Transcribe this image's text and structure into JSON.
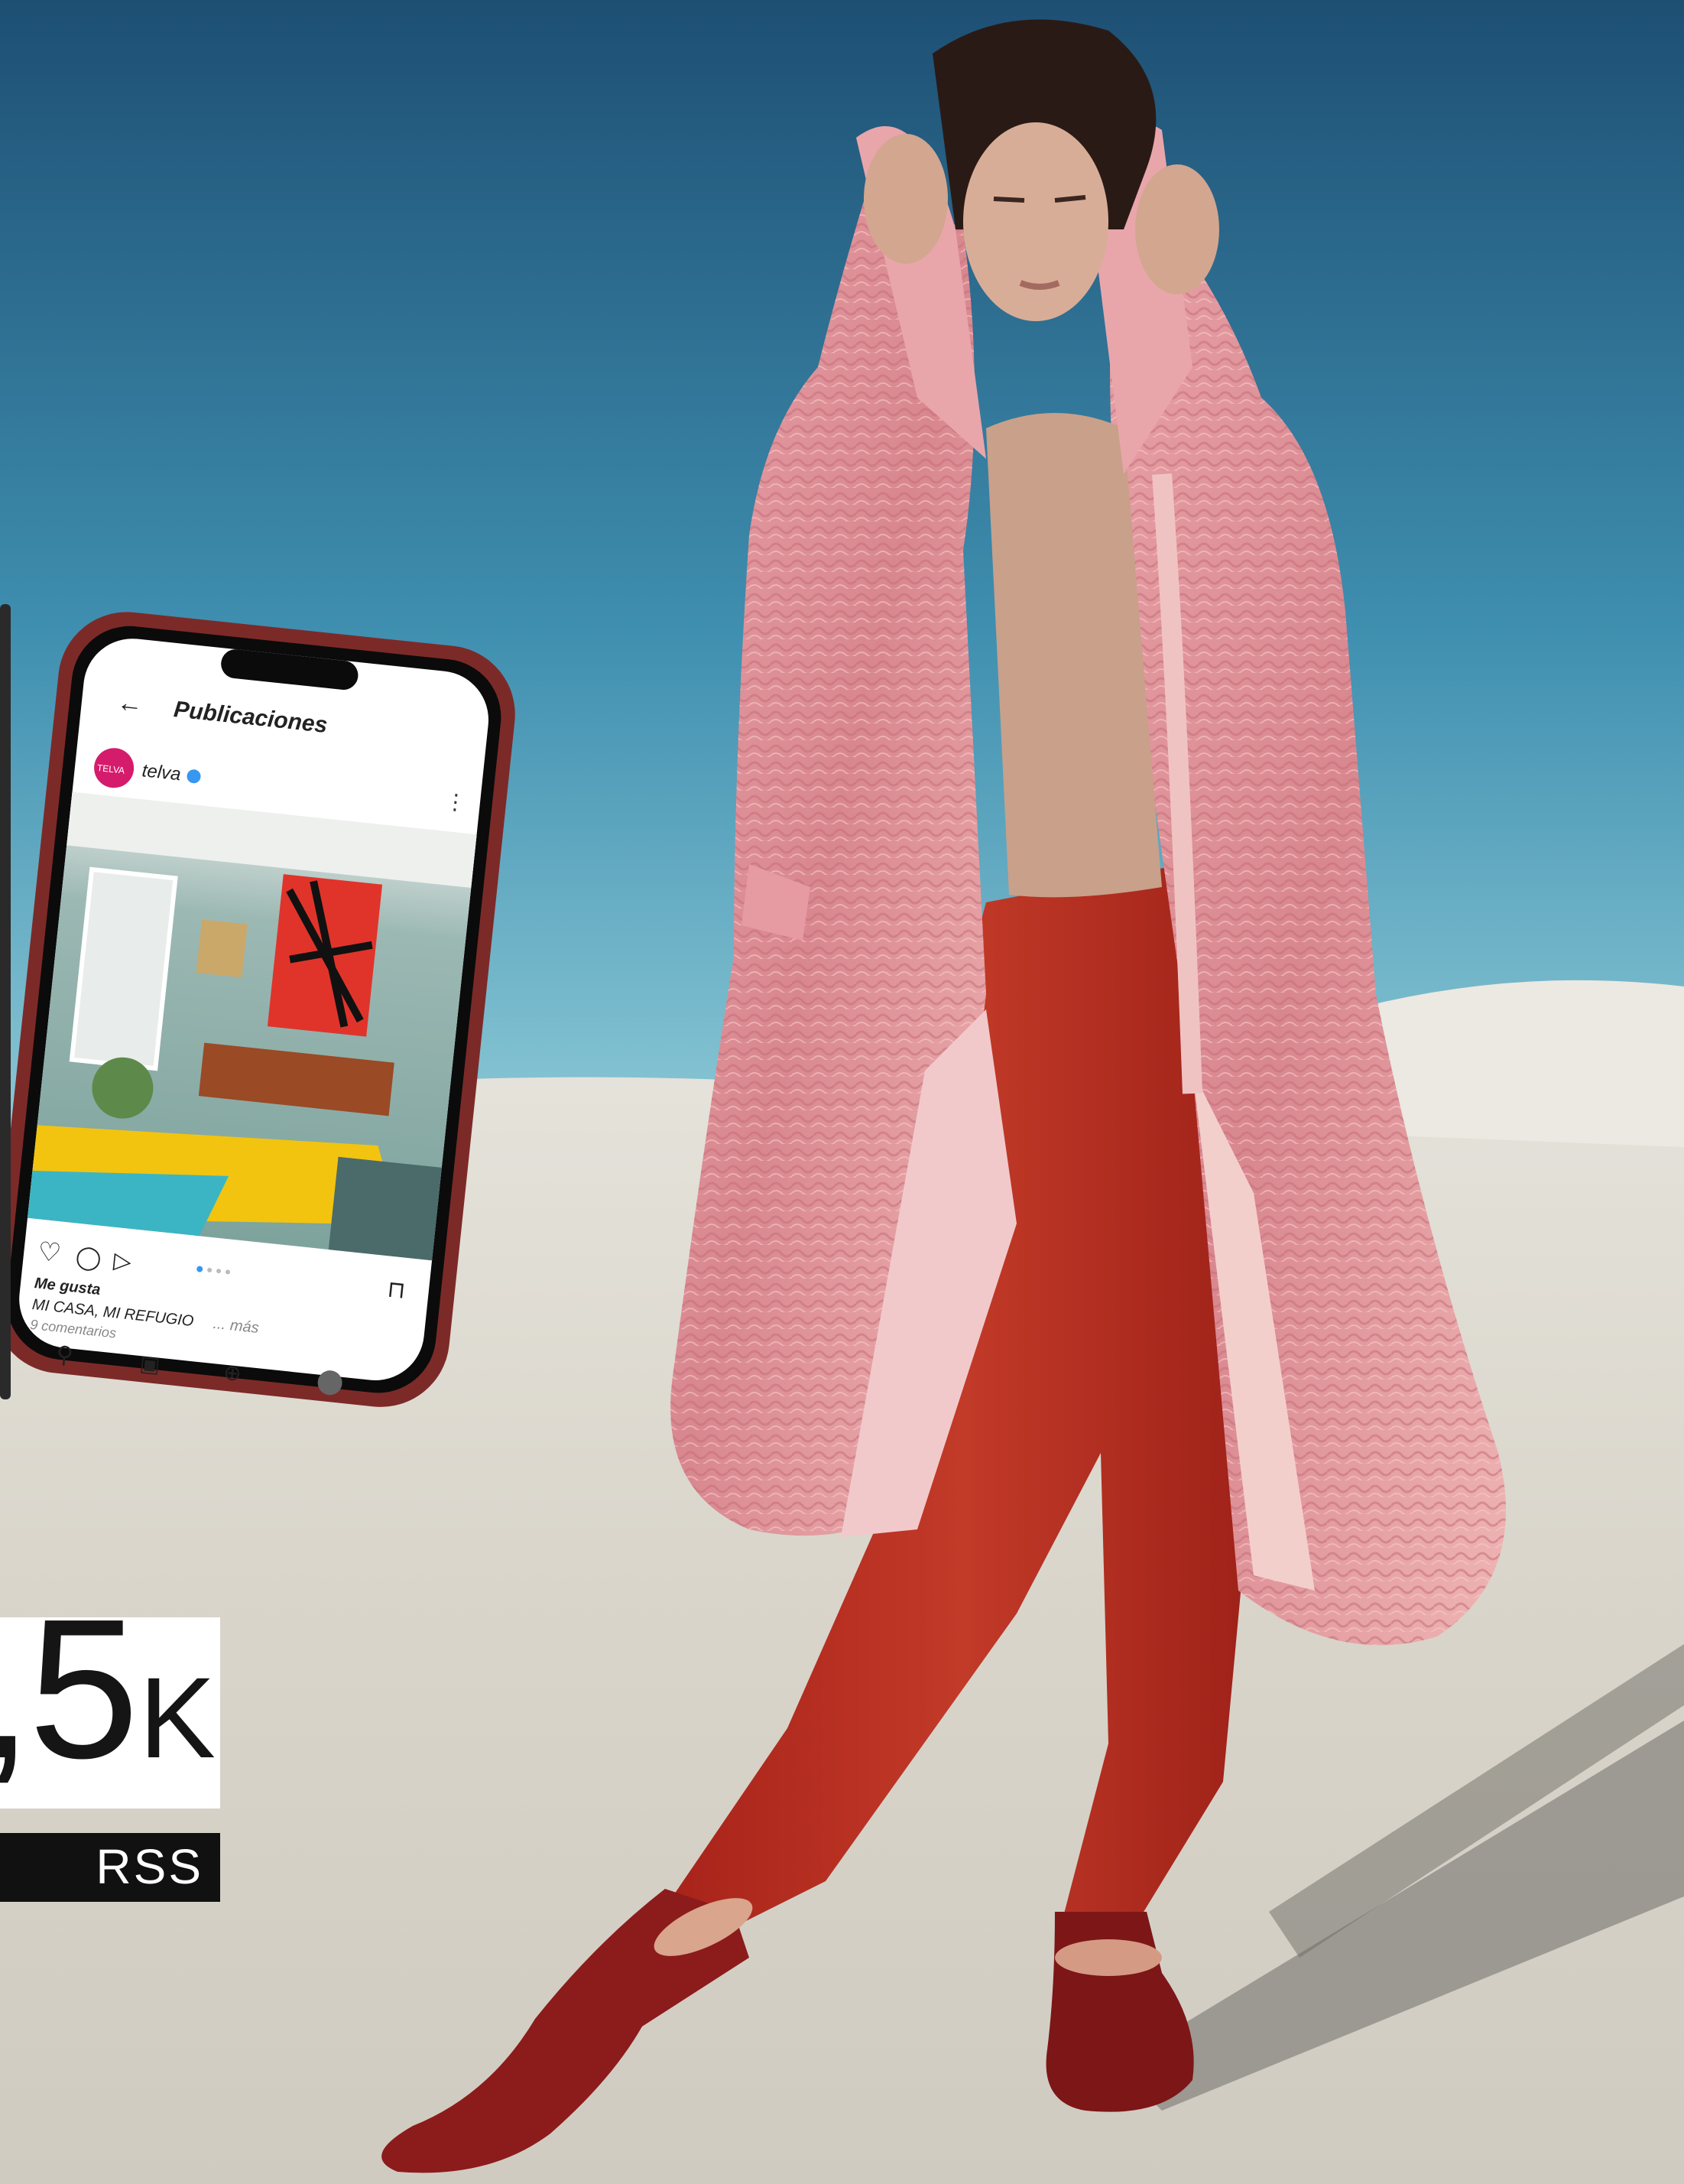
{
  "scene": {
    "sky_top": "#1f5478",
    "sky_bottom": "#7fc3d4",
    "sand": "#dedbd2",
    "coat": "#e39aa0",
    "trousers": "#b52a1e",
    "shoes": "#8f1c1c",
    "phone_frame": "#7c2a28"
  },
  "phone": {
    "header_title": "Publicaciones",
    "account_name": "telva",
    "avatar_text": "TELVA",
    "likes_text": "Me gusta",
    "caption": "MI CASA, MI REFUGIO",
    "caption_more": "... más",
    "comments": "9 comentarios",
    "icons": [
      "back-arrow-icon",
      "verified-icon",
      "more-icon",
      "heart-icon",
      "comment-icon",
      "share-icon",
      "bookmark-icon",
      "home-icon",
      "search-icon",
      "reels-icon",
      "shop-icon",
      "profile-icon"
    ]
  },
  "stat": {
    "number": ",5",
    "unit": "K",
    "label": "RSS"
  }
}
